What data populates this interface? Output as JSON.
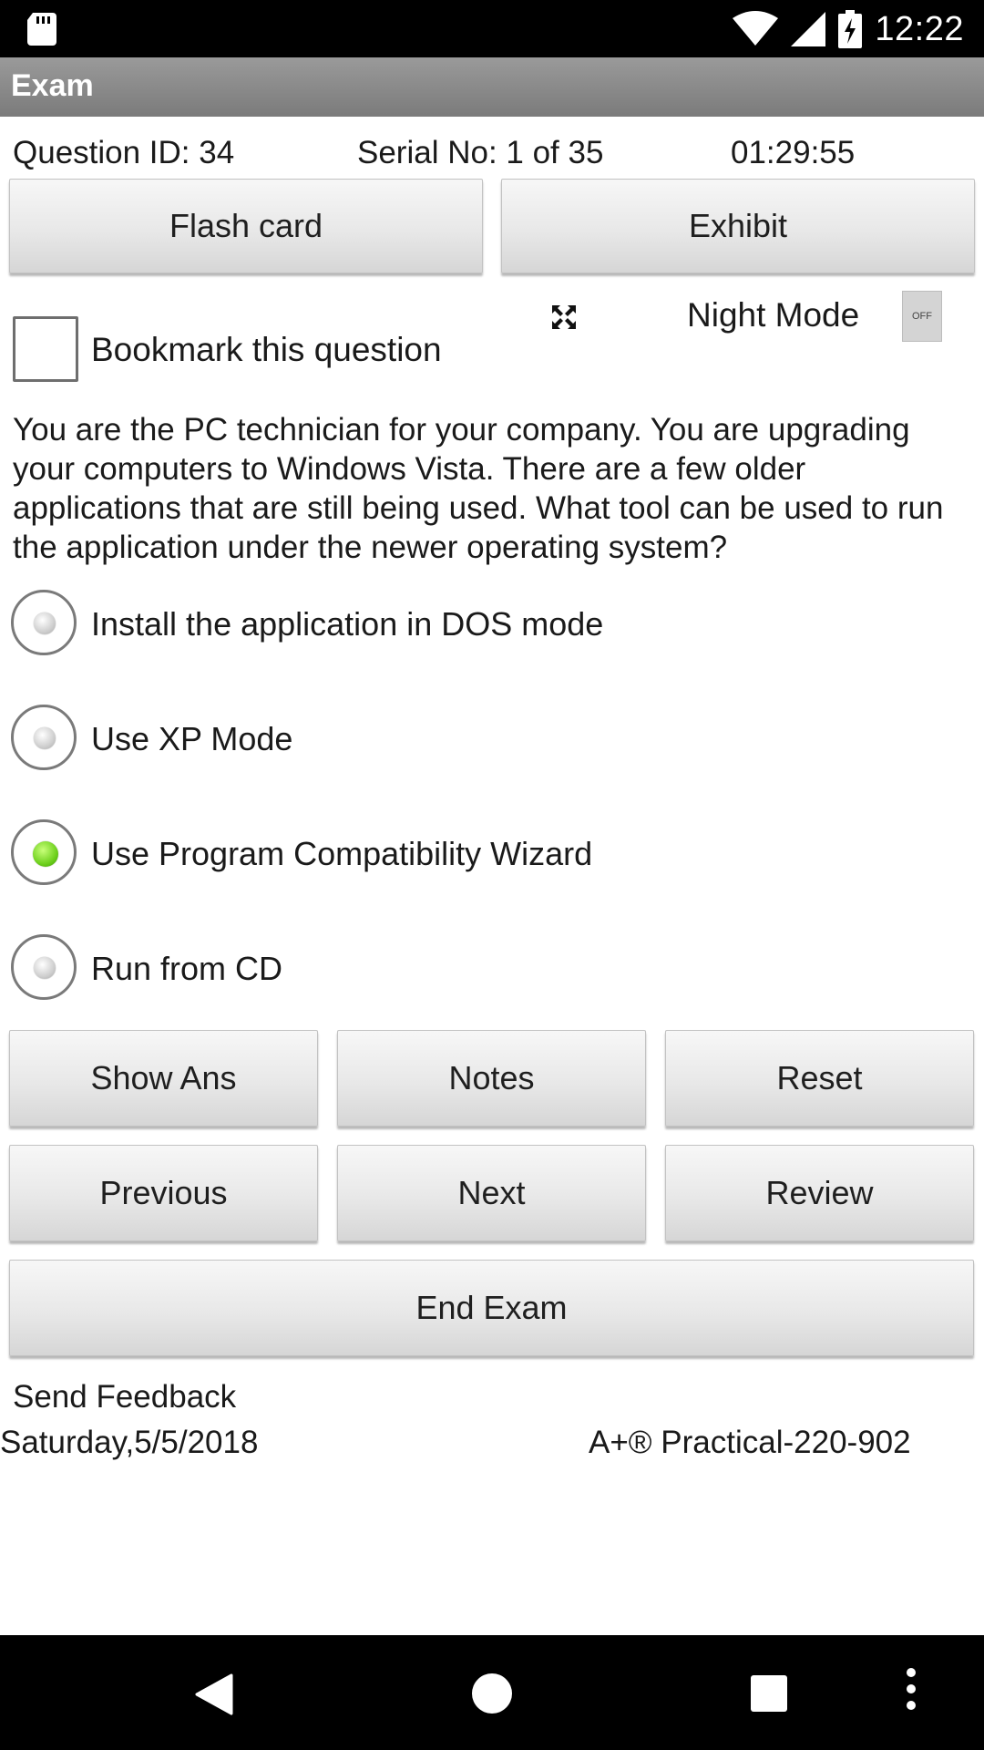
{
  "status_bar": {
    "time": "12:22",
    "icons": [
      "sd-card-icon",
      "wifi-icon",
      "cell-signal-icon",
      "battery-charging-icon"
    ]
  },
  "app_bar": {
    "title": "Exam"
  },
  "info": {
    "question_id": "Question ID: 34",
    "serial": "Serial No: 1 of 35",
    "timer": "01:29:55"
  },
  "top_buttons": {
    "flash_card": "Flash card",
    "exhibit": "Exhibit"
  },
  "bookmark": {
    "label": "Bookmark this question",
    "checked": false
  },
  "night_mode": {
    "label": "Night Mode",
    "toggle_text": "OFF"
  },
  "question": {
    "text": "You are the PC technician for your company. You are upgrading your computers to Windows Vista. There are a few older applications that are still being used. What tool can be used to run the application under the newer operating system?"
  },
  "options": [
    {
      "label": "Install the application in DOS mode",
      "selected": false
    },
    {
      "label": "Use XP Mode",
      "selected": false
    },
    {
      "label": "Use Program Compatibility Wizard",
      "selected": true
    },
    {
      "label": "Run from CD",
      "selected": false
    }
  ],
  "buttons": {
    "show_ans": "Show Ans",
    "notes": "Notes",
    "reset": "Reset",
    "previous": "Previous",
    "next": "Next",
    "review": "Review",
    "end_exam": "End Exam"
  },
  "footer": {
    "feedback": "Send Feedback",
    "date": "Saturday,5/5/2018",
    "certification": "A+® Practical-220-902"
  },
  "colors": {
    "app_bar": "#8a8a8a",
    "selected_radio": "#6fd11e",
    "system_bars": "#000000"
  }
}
